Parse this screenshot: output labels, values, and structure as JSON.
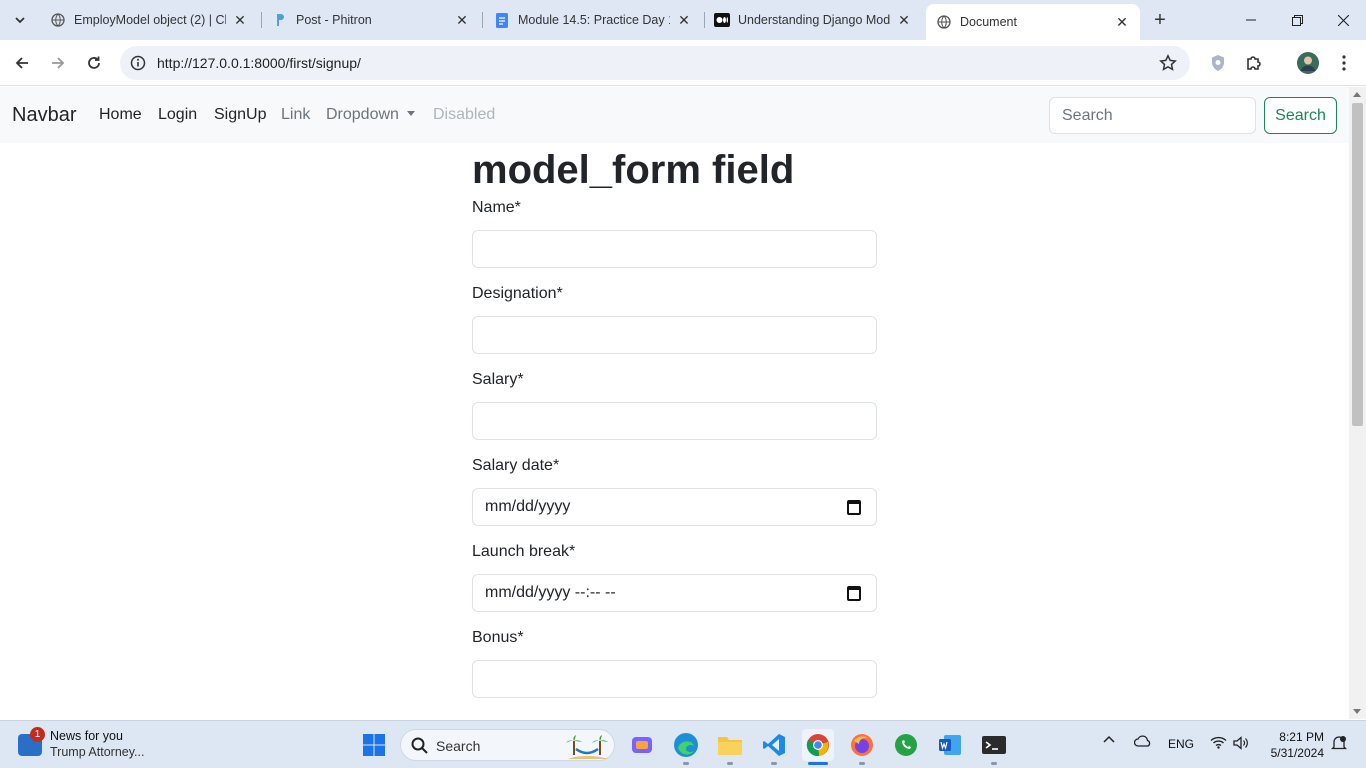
{
  "browser": {
    "tabs": [
      {
        "title": "EmployModel object (2) | Ch",
        "icon": "globe-icon",
        "active": false
      },
      {
        "title": "Post - Phitron",
        "icon": "phitron-icon",
        "active": false
      },
      {
        "title": "Module 14.5: Practice Day 1",
        "icon": "docs-icon",
        "active": false
      },
      {
        "title": "Understanding Django Mod",
        "icon": "medium-icon",
        "active": false
      },
      {
        "title": "Document",
        "icon": "globe-icon",
        "active": true
      }
    ],
    "url": "http://127.0.0.1:8000/first/signup/"
  },
  "navbar": {
    "brand": "Navbar",
    "links": [
      "Home",
      "Login",
      "SignUp",
      "Link",
      "Dropdown",
      "Disabled"
    ],
    "search_placeholder": "Search",
    "search_button": "Search"
  },
  "form": {
    "heading": "model_form field",
    "fields": [
      {
        "label": "Name*",
        "value": ""
      },
      {
        "label": "Designation*",
        "value": ""
      },
      {
        "label": "Salary*",
        "value": ""
      },
      {
        "label": "Salary date*",
        "value": "mm/dd/yyyy"
      },
      {
        "label": "Launch break*",
        "value": "mm/dd/yyyy --:-- --"
      },
      {
        "label": "Bonus*",
        "value": ""
      }
    ]
  },
  "taskbar": {
    "news_badge": "1",
    "news_title": "News for you",
    "news_subtitle": "Trump Attorney...",
    "search_label": "Search",
    "language": "ENG",
    "time": "8:21 PM",
    "date": "5/31/2024"
  },
  "colors": {
    "success": "#198754",
    "navbar_bg": "#f8f9fa",
    "chrome_bg": "#dfe7f5"
  }
}
